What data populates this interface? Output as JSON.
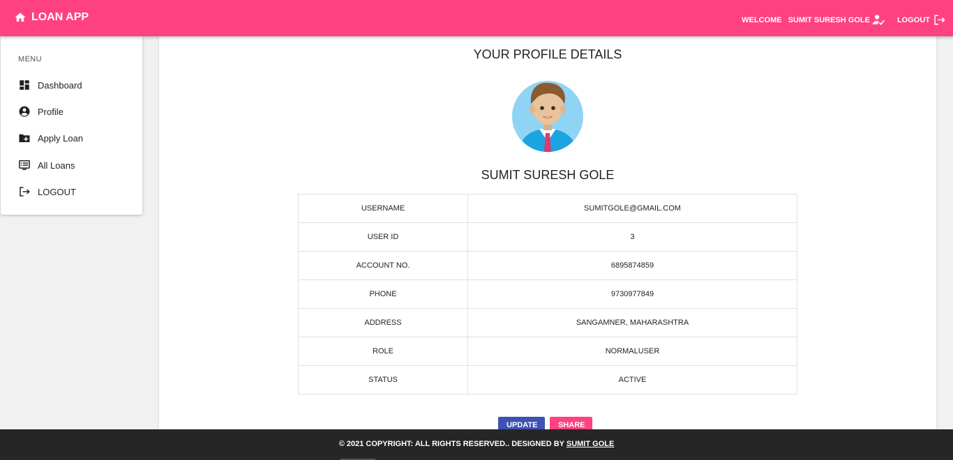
{
  "app": {
    "title": "LOAN APP"
  },
  "topbar": {
    "welcome": "WELCOME",
    "username": "SUMIT SURESH GOLE",
    "logout": "LOGOUT"
  },
  "sidebar": {
    "heading": "MENU",
    "items": [
      {
        "label": "Dashboard",
        "icon": "dashboard-icon"
      },
      {
        "label": "Profile",
        "icon": "account-circle-icon"
      },
      {
        "label": "Apply Loan",
        "icon": "folder-add-icon"
      },
      {
        "label": "All Loans",
        "icon": "list-alt-icon"
      },
      {
        "label": "LOGOUT",
        "icon": "logout-icon"
      }
    ]
  },
  "profile": {
    "title": "YOUR PROFILE DETAILS",
    "name": "SUMIT SURESH GOLE",
    "rows": [
      {
        "key": "USERNAME",
        "value": "SUMITGOLE@GMAIL.COM"
      },
      {
        "key": "USER ID",
        "value": "3"
      },
      {
        "key": "ACCOUNT NO.",
        "value": "6895874859"
      },
      {
        "key": "PHONE",
        "value": "9730977849"
      },
      {
        "key": "ADDRESS",
        "value": "SANGAMNER, MAHARASHTRA"
      },
      {
        "key": "ROLE",
        "value": "NORMALUSER"
      },
      {
        "key": "STATUS",
        "value": "ACTIVE"
      }
    ],
    "update_label": "UPDATE",
    "share_label": "SHARE"
  },
  "footer": {
    "text": "© 2021 COPYRIGHT: ALL RIGHTS RESERVED.. DESIGNED BY",
    "link": "SUMIT GOLE"
  },
  "colors": {
    "primary": "#ff4081",
    "update_button": "#3f51b5",
    "footer": "#262626"
  }
}
